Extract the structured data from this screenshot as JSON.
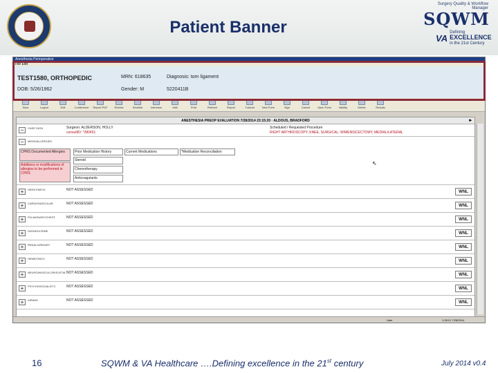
{
  "slide": {
    "title": "Patient Banner",
    "page_number": "16",
    "footer_text": "SQWM & VA Healthcare ….Defining excellence in the 21",
    "footer_sup": "st",
    "footer_tail": " century",
    "footer_right": "July 2014 v0.4"
  },
  "logo": {
    "top_line": "Surgery Quality & Workflow Manager",
    "word": "SQWM",
    "va": "VA",
    "va_sub": "HEALTH CARE",
    "defining": "Defining",
    "excellence": "EXCELLENCE",
    "century": "in the 21st Century"
  },
  "app": {
    "window_title": "Anesthesia Perioperative",
    "menu": "File   Edit",
    "patient_name": "TEST1580, ORTHOPEDIC",
    "dob": "DOB: 5/26/1962",
    "mrn_label": "MRN: 618635",
    "gender": "Gender: M",
    "diagnosis": "Diagnosis: torn ligament",
    "ssn": "5220411B",
    "toolbar": [
      "Save",
      "Logout",
      "Edit",
      "Conference",
      "Report PDF",
      "Review",
      "Worklist",
      "Interview",
      "Halt",
      "Print",
      "Refresh",
      "Report",
      "Tutorial",
      "New Form",
      "Sign",
      "Cancel",
      "Open Form",
      "Validity",
      "Delete",
      "Results"
    ],
    "form_title": "ANESTHESIA PREOP EVALUATION 7/28/2014 23:15:20 · ALDOUS, BRADFORD",
    "case_data_label": "CASE DATA",
    "surgeon": "Surgeon: ALDERSON, HOLLY",
    "consult": "consultID: *280451",
    "scheduled": "Scheduled / Requested Procedure",
    "procedure": "RIGHT ARTHROSCOPY, KNEE, SURGICAL; W/MENISCECTOMY, MEDIAL/LATERAL",
    "med_allergies": "MEDS/ALLERGIES",
    "cprs_box": "CPRS Documented Allergies",
    "additions_box": "Additions or modifications of allergies to be performed in CPRS",
    "prior_med_history": "Prior Medication History",
    "current_meds": "Current Medications",
    "med_reconciliation": "*Medication Reconciliation",
    "med_items": [
      "Steroid",
      "Chemotherapy",
      "Anticoagulants"
    ],
    "sections": [
      {
        "name": "HEENT/NECK",
        "status": "NOT ASSESSED",
        "wnl": "WNL"
      },
      {
        "name": "CARDIOVASCULAR",
        "status": "NOT ASSESSED",
        "wnl": "WNL"
      },
      {
        "name": "PULMONARY/CHEST",
        "status": "NOT ASSESSED",
        "wnl": "WNL"
      },
      {
        "name": "GI/ENDOCRINE",
        "status": "NOT ASSESSED",
        "wnl": "WNL"
      },
      {
        "name": "RENAL/URINARY",
        "status": "NOT ASSESSED",
        "wnl": "WNL"
      },
      {
        "name": "HEME/ONCO",
        "status": "NOT ASSESSED",
        "wnl": "WNL"
      },
      {
        "name": "NEURO/MUSCULOSKELETAL",
        "status": "NOT ASSESSED",
        "wnl": "WNL"
      },
      {
        "name": "PSYCHOSOCIAL/ETC",
        "status": "NOT ASSESSED",
        "wnl": "WNL"
      },
      {
        "name": "AIRWAY",
        "status": "NOT ASSESSED",
        "wnl": "WNL"
      }
    ],
    "status_bar_user": "User",
    "status_bar_right": "1:28:21 7/28/2014"
  }
}
